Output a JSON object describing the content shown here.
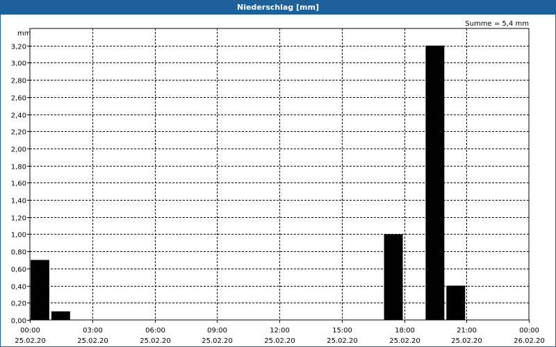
{
  "window": {
    "title": "Niederschlag [mm]"
  },
  "chart_data": {
    "type": "bar",
    "title": "Niederschlag [mm]",
    "ylabel": "mm",
    "sum_label": "Summe = 5,4 mm",
    "ylim": [
      0,
      3.4
    ],
    "yticks": [
      0,
      0.2,
      0.4,
      0.6,
      0.8,
      1.0,
      1.2,
      1.4,
      1.6,
      1.8,
      2.0,
      2.2,
      2.4,
      2.6,
      2.8,
      3.0,
      3.2
    ],
    "ytick_labels": [
      "0,00",
      "0,20",
      "0,40",
      "0,60",
      "0,80",
      "1,00",
      "1,20",
      "1,40",
      "1,60",
      "1,80",
      "2,00",
      "2,20",
      "2,40",
      "2,60",
      "2,80",
      "3,00",
      "3,20"
    ],
    "xlim_hours": [
      0,
      24
    ],
    "xticks": [
      {
        "hour": 0,
        "time": "00:00",
        "date": "25.02.20"
      },
      {
        "hour": 3,
        "time": "03:00",
        "date": "25.02.20"
      },
      {
        "hour": 6,
        "time": "06:00",
        "date": "25.02.20"
      },
      {
        "hour": 9,
        "time": "09:00",
        "date": "25.02.20"
      },
      {
        "hour": 12,
        "time": "12:00",
        "date": "25.02.20"
      },
      {
        "hour": 15,
        "time": "15:00",
        "date": "25.02.20"
      },
      {
        "hour": 18,
        "time": "18:00",
        "date": "25.02.20"
      },
      {
        "hour": 21,
        "time": "21:00",
        "date": "25.02.20"
      },
      {
        "hour": 24,
        "time": "00:00",
        "date": "26.02.20"
      }
    ],
    "bars": [
      {
        "hour_start": 0,
        "hour_end": 1,
        "value": 0.7
      },
      {
        "hour_start": 1,
        "hour_end": 2,
        "value": 0.1
      },
      {
        "hour_start": 17,
        "hour_end": 18,
        "value": 1.0
      },
      {
        "hour_start": 19,
        "hour_end": 20,
        "value": 3.2
      },
      {
        "hour_start": 20,
        "hour_end": 21,
        "value": 0.4
      }
    ],
    "grid": true,
    "bar_color": "#000000"
  }
}
